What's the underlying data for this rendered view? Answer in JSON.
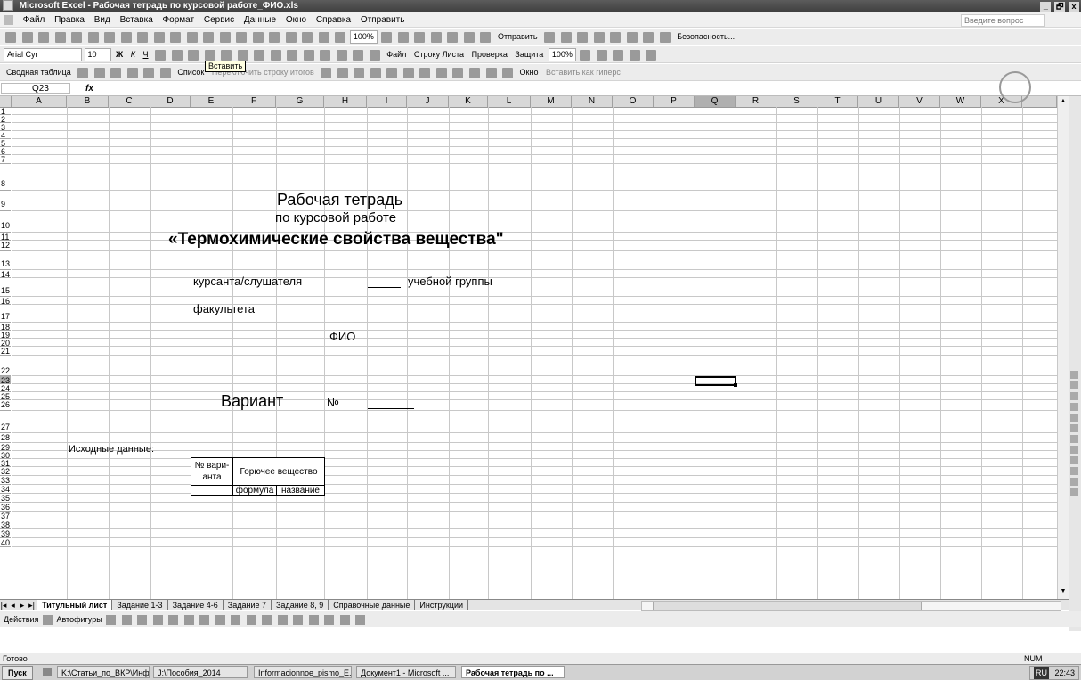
{
  "window": {
    "title": "Microsoft Excel - Рабочая тетрадь по курсовой работе_ФИО.xls",
    "controls": [
      "_",
      "🗗",
      "x"
    ]
  },
  "menu": {
    "items": [
      "Файл",
      "Правка",
      "Вид",
      "Вставка",
      "Формат",
      "Сервис",
      "Данные",
      "Окно",
      "Справка",
      "Отправить"
    ],
    "help_placeholder": "Введите вопрос"
  },
  "toolbar1": {
    "zoom": "100%",
    "send_label": "Отправить",
    "security_label": "Безопасность..."
  },
  "toolbar2": {
    "font": "Arial Cyr",
    "size": "10",
    "bold": "Ж",
    "italic": "К",
    "underline": "Ч",
    "tooltip": "Вставить",
    "file_label": "Файл",
    "row_label": "Строку Листа",
    "check_label": "Проверка",
    "protect_label": "Защита",
    "zoom": "100%"
  },
  "toolbar3": {
    "pivot_label": "Сводная таблица",
    "list_label": "Список",
    "toggle_label": "Переключить строку итогов",
    "window_label": "Окно",
    "insert_label": "Вставить как гиперс"
  },
  "formula_bar": {
    "name_box": "Q23",
    "fx": "fx",
    "value": ""
  },
  "columns": [
    "A",
    "B",
    "C",
    "D",
    "E",
    "F",
    "G",
    "H",
    "I",
    "J",
    "K",
    "L",
    "M",
    "N",
    "O",
    "P",
    "Q",
    "R",
    "S",
    "T",
    "U",
    "V",
    "W",
    "X"
  ],
  "rows": [
    "1",
    "2",
    "3",
    "4",
    "5",
    "6",
    "7",
    "8",
    "9",
    "10",
    "11",
    "12",
    "13",
    "14",
    "15",
    "16",
    "17",
    "18",
    "19",
    "20",
    "21",
    "22",
    "23",
    "24",
    "25",
    "26",
    "27",
    "28",
    "29",
    "30",
    "31",
    "32",
    "33",
    "34",
    "35",
    "36",
    "37",
    "38",
    "39",
    "40"
  ],
  "sheet": {
    "title": "Рабочая тетрадь",
    "subtitle": "по курсовой работе",
    "topic": "«Термохимические свойства вещества\"",
    "cadet": "курсанта/слушателя",
    "group": "учебной группы",
    "faculty": "факультета",
    "fio": "ФИО",
    "variant": "Вариант",
    "number_sign": "№",
    "source_data": "Исходные данные:",
    "table": {
      "col1": "№ вари-анта",
      "col2": "Горючее вещество",
      "sub1": "формула",
      "sub2": "название"
    }
  },
  "sheet_tabs": [
    "Титульный лист",
    "Задание 1-3",
    "Задание 4-6",
    "Задание 7",
    "Задание 8, 9",
    "Справочные данные",
    "Инструкции"
  ],
  "active_tab": "Титульный лист",
  "drawing_bar": {
    "actions": "Действия",
    "autoshapes": "Автофигуры"
  },
  "status": {
    "text": "Готово",
    "num": "NUM"
  },
  "taskbar": {
    "start": "Пуск",
    "tasks": [
      {
        "label": "K:\\Статьи_по_ВКР\\Инф..."
      },
      {
        "label": "J:\\Пособия_2014"
      },
      {
        "label": "Informacionnoe_pismo_E..."
      },
      {
        "label": "Документ1 - Microsoft ..."
      },
      {
        "label": "Рабочая тетрадь по ..."
      }
    ],
    "lang": "RU",
    "time": "22:43"
  }
}
